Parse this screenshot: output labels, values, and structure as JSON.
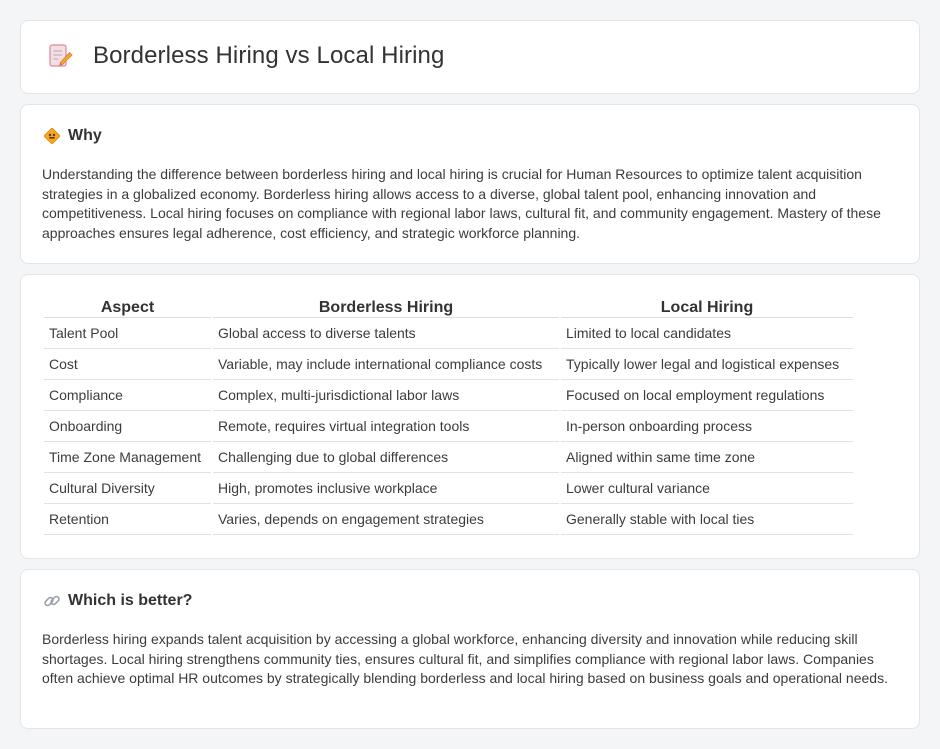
{
  "header": {
    "title": "Borderless Hiring vs Local Hiring",
    "icon": "document-pencil-icon"
  },
  "why": {
    "heading": "Why",
    "icon": "diamond-sign-icon",
    "body": "Understanding the difference between borderless hiring and local hiring is crucial for Human Resources to optimize talent acquisition strategies in a globalized economy. Borderless hiring allows access to a diverse, global talent pool, enhancing innovation and competitiveness. Local hiring focuses on compliance with regional labor laws, cultural fit, and community engagement. Mastery of these approaches ensures legal adherence, cost efficiency, and strategic workforce planning."
  },
  "comparison": {
    "headers": [
      "Aspect",
      "Borderless Hiring",
      "Local Hiring"
    ],
    "rows": [
      [
        "Talent Pool",
        "Global access to diverse talents",
        "Limited to local candidates"
      ],
      [
        "Cost",
        "Variable, may include international compliance costs",
        "Typically lower legal and logistical expenses"
      ],
      [
        "Compliance",
        "Complex, multi-jurisdictional labor laws",
        "Focused on local employment regulations"
      ],
      [
        "Onboarding",
        "Remote, requires virtual integration tools",
        "In-person onboarding process"
      ],
      [
        "Time Zone Management",
        "Challenging due to global differences",
        "Aligned within same time zone"
      ],
      [
        "Cultural Diversity",
        "High, promotes inclusive workplace",
        "Lower cultural variance"
      ],
      [
        "Retention",
        "Varies, depends on engagement strategies",
        "Generally stable with local ties"
      ]
    ]
  },
  "better": {
    "heading": "Which is better?",
    "icon": "link-icon",
    "body": "Borderless hiring expands talent acquisition by accessing a global workforce, enhancing diversity and innovation while reducing skill shortages. Local hiring strengthens community ties, ensures cultural fit, and simplifies compliance with regional labor laws. Companies often achieve optimal HR outcomes by strategically blending borderless and local hiring based on business goals and operational needs."
  },
  "colors": {
    "background": "#f4f5f7",
    "card": "#ffffff",
    "accent_orange": "#f5a623",
    "icon_pink": "#e8607a"
  }
}
